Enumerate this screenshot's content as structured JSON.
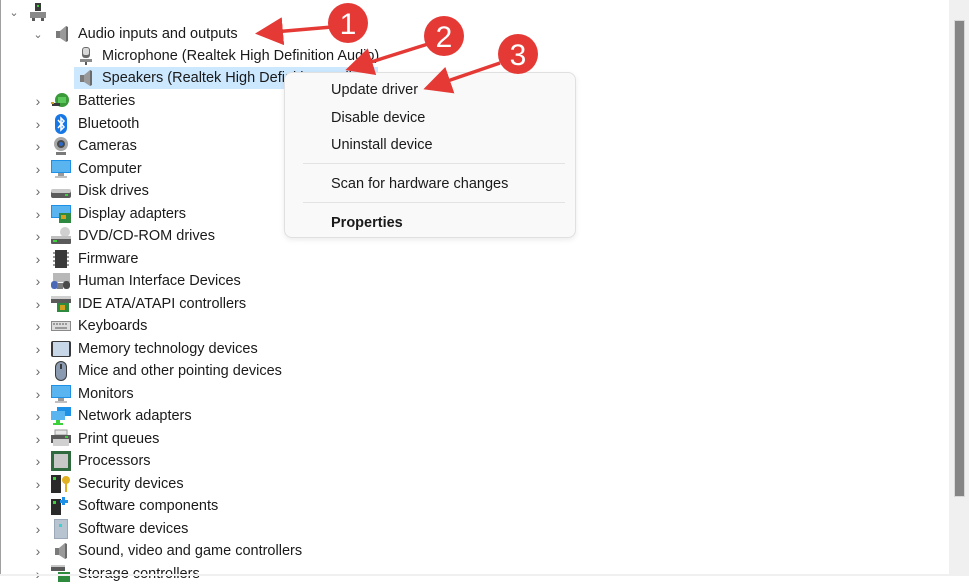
{
  "tree": {
    "root": {
      "label": "",
      "icon": "computer-root-icon",
      "expanded": true
    },
    "audio": {
      "label": "Audio inputs and outputs",
      "icon": "speaker-icon",
      "expanded": true,
      "children": [
        {
          "label": "Microphone (Realtek High Definition Audio)",
          "icon": "microphone-icon",
          "selected": false
        },
        {
          "label": "Speakers (Realtek High Definition Audio)",
          "icon": "speaker-icon",
          "selected": true
        }
      ]
    },
    "categories": [
      {
        "label": "Batteries",
        "icon": "battery-icon"
      },
      {
        "label": "Bluetooth",
        "icon": "bluetooth-icon"
      },
      {
        "label": "Cameras",
        "icon": "camera-icon"
      },
      {
        "label": "Computer",
        "icon": "computer-icon"
      },
      {
        "label": "Disk drives",
        "icon": "disk-drive-icon"
      },
      {
        "label": "Display adapters",
        "icon": "display-adapter-icon"
      },
      {
        "label": "DVD/CD-ROM drives",
        "icon": "dvd-drive-icon"
      },
      {
        "label": "Firmware",
        "icon": "firmware-chip-icon"
      },
      {
        "label": "Human Interface Devices",
        "icon": "hid-icon"
      },
      {
        "label": "IDE ATA/ATAPI controllers",
        "icon": "ide-controller-icon"
      },
      {
        "label": "Keyboards",
        "icon": "keyboard-icon"
      },
      {
        "label": "Memory technology devices",
        "icon": "memory-device-icon"
      },
      {
        "label": "Mice and other pointing devices",
        "icon": "mouse-icon"
      },
      {
        "label": "Monitors",
        "icon": "monitor-icon"
      },
      {
        "label": "Network adapters",
        "icon": "network-adapter-icon"
      },
      {
        "label": "Print queues",
        "icon": "printer-icon"
      },
      {
        "label": "Processors",
        "icon": "processor-icon"
      },
      {
        "label": "Security devices",
        "icon": "security-device-icon"
      },
      {
        "label": "Software components",
        "icon": "software-component-icon"
      },
      {
        "label": "Software devices",
        "icon": "software-device-icon"
      },
      {
        "label": "Sound, video and game controllers",
        "icon": "sound-controller-icon"
      },
      {
        "label": "Storage controllers",
        "icon": "storage-controller-icon"
      }
    ]
  },
  "context_menu": {
    "items": [
      {
        "label": "Update driver",
        "bold": false
      },
      {
        "label": "Disable device",
        "bold": false
      },
      {
        "label": "Uninstall device",
        "bold": false
      },
      {
        "label": "Scan for hardware changes",
        "bold": false
      },
      {
        "label": "Properties",
        "bold": true
      }
    ]
  },
  "annotations": {
    "color": "#e53935",
    "badges": [
      "1",
      "2",
      "3"
    ]
  },
  "colors": {
    "selection": "#cce8ff",
    "menu_bg": "#f9f9f9",
    "scroll_thumb": "#858585"
  }
}
